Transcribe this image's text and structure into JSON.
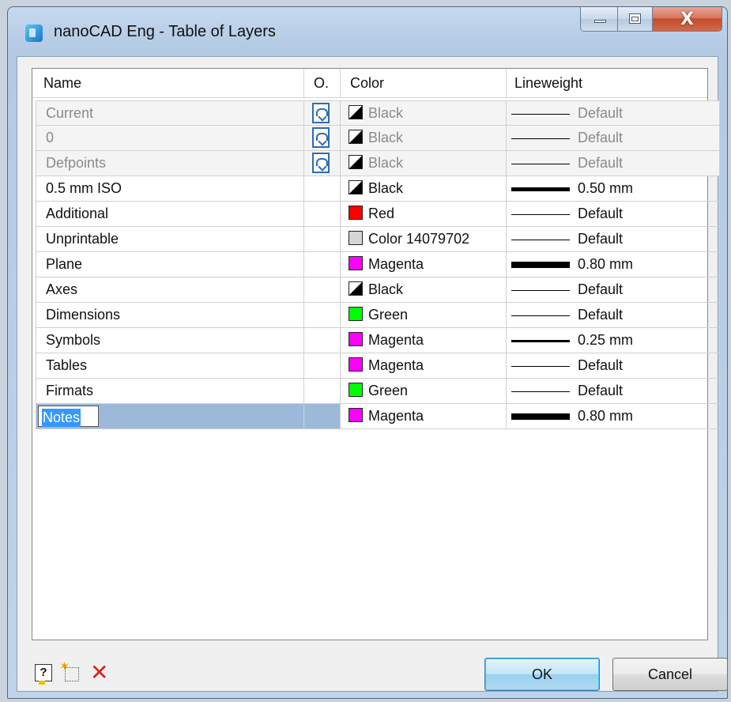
{
  "window": {
    "title": "nanoCAD Eng - Table of Layers",
    "close_glyph": "X"
  },
  "columns": {
    "name": "Name",
    "on": "O.",
    "color": "Color",
    "lineweight": "Lineweight"
  },
  "layers": [
    {
      "name": "Current",
      "color_name": "Black",
      "color_hex": "black",
      "lineweight": "Default",
      "system": true
    },
    {
      "name": "0",
      "color_name": "Black",
      "color_hex": "black",
      "lineweight": "Default",
      "system": true
    },
    {
      "name": "Defpoints",
      "color_name": "Black",
      "color_hex": "black",
      "lineweight": "Default",
      "system": true
    },
    {
      "name": "0.5 mm ISO",
      "color_name": "Black",
      "color_hex": "black",
      "lineweight": "0.50 mm"
    },
    {
      "name": "Additional",
      "color_name": "Red",
      "color_hex": "#ff0000",
      "lineweight": "Default"
    },
    {
      "name": "Unprintable",
      "color_name": "Color 14079702",
      "color_hex": "#d6d6d6",
      "lineweight": "Default"
    },
    {
      "name": "Plane",
      "color_name": "Magenta",
      "color_hex": "#ff00ff",
      "lineweight": "0.80 mm"
    },
    {
      "name": "Axes",
      "color_name": "Black",
      "color_hex": "black",
      "lineweight": "Default"
    },
    {
      "name": "Dimensions",
      "color_name": "Green",
      "color_hex": "#00ff00",
      "lineweight": "Default"
    },
    {
      "name": "Symbols",
      "color_name": "Magenta",
      "color_hex": "#ff00ff",
      "lineweight": "0.25 mm"
    },
    {
      "name": "Tables",
      "color_name": "Magenta",
      "color_hex": "#ff00ff",
      "lineweight": "Default"
    },
    {
      "name": "Firmats",
      "color_name": "Green",
      "color_hex": "#00ff00",
      "lineweight": "Default"
    },
    {
      "name": "Notes",
      "color_name": "Magenta",
      "color_hex": "#ff00ff",
      "lineweight": "0.80 mm",
      "selected": true,
      "editing": true
    }
  ],
  "toolbar": {
    "help_icon": "help-icon",
    "new_layer_icon": "new-layer-icon",
    "delete_icon": "delete-icon",
    "help_glyph": "?",
    "delete_glyph": "✕"
  },
  "buttons": {
    "ok": "OK",
    "cancel": "Cancel"
  }
}
